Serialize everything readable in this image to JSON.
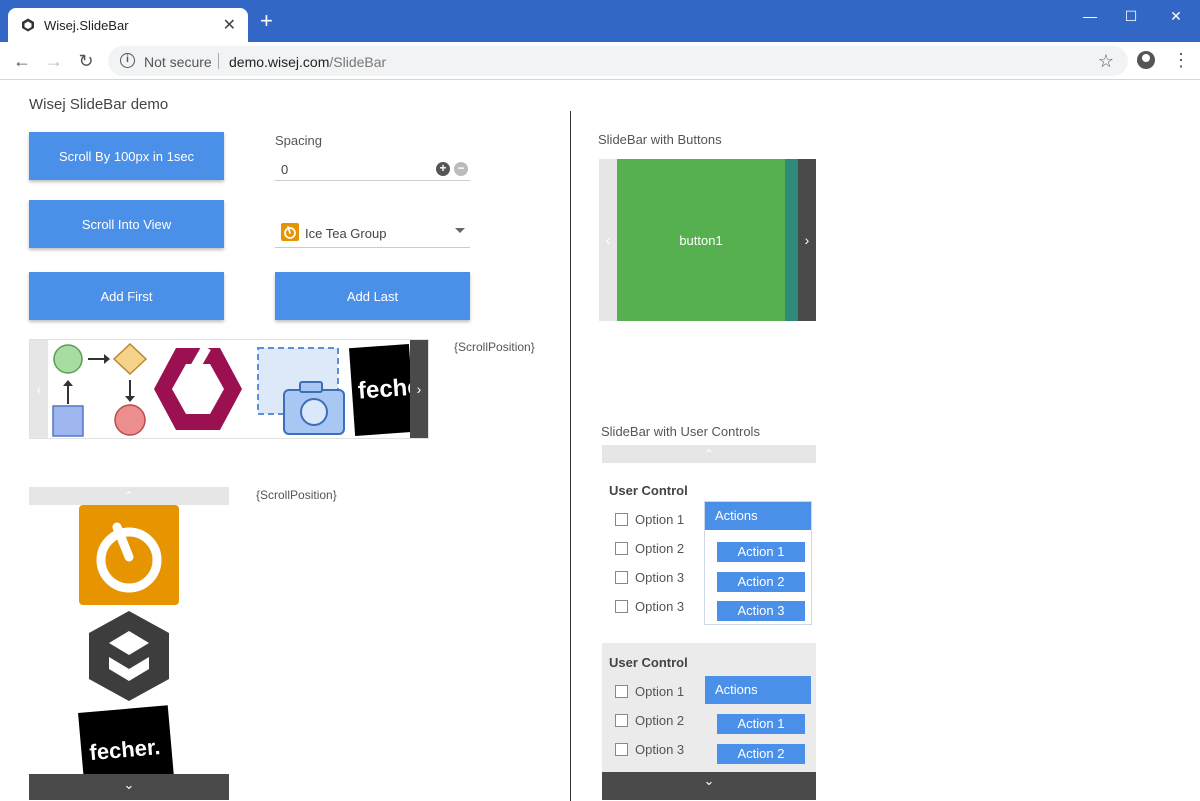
{
  "browser": {
    "tab_title": "Wisej.SlideBar",
    "tab_close": "✕",
    "new_tab": "+",
    "minimize": "—",
    "maximize": "☐",
    "close": "✕",
    "not_secure": "Not secure",
    "url_host": "demo.wisej.com",
    "url_path": "/SlideBar",
    "back": "←",
    "forward": "→",
    "reload": "↻",
    "star": "☆",
    "menu": "⋮"
  },
  "page": {
    "title": "Wisej SlideBar demo",
    "buttons": {
      "scroll_by": "Scroll By 100px in 1sec",
      "scroll_into_view": "Scroll Into View",
      "add_first": "Add First",
      "add_last": "Add Last"
    },
    "spacing_label": "Spacing",
    "spacing_value": "0",
    "combo_value": "Ice Tea Group",
    "scroll_position_1": "{ScrollPosition}",
    "scroll_position_2": "{ScrollPosition}",
    "logo_text": "fecher",
    "logo_text_full": "fecher."
  },
  "right": {
    "buttons_label": "SlideBar with Buttons",
    "button1": "button1",
    "user_controls_label": "SlideBar with User Controls",
    "user_control_1": {
      "title": "User Control",
      "options": [
        "Option 1",
        "Option 2",
        "Option 3",
        "Option 3"
      ],
      "actions_title": "Actions",
      "actions": [
        "Action 1",
        "Action 2",
        "Action 3"
      ]
    },
    "user_control_2": {
      "title": "User Control",
      "options": [
        "Option 1",
        "Option 2",
        "Option 3"
      ],
      "actions_title": "Actions",
      "actions": [
        "Action 1",
        "Action 2"
      ]
    }
  },
  "colors": {
    "accent_blue": "#4a90e9",
    "chrome_blue": "#3367c6",
    "green_button": "#57b050",
    "teal_button": "#2e8b7a",
    "dark_arrow": "#4a4a4a",
    "orange_logo": "#e69500",
    "crimson_logo": "#9b1050"
  }
}
